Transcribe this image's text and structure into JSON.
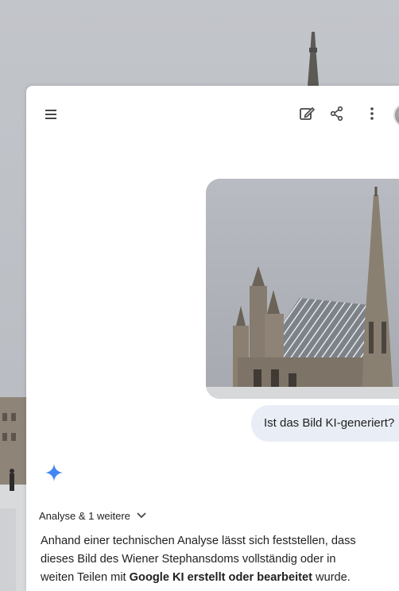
{
  "toolbar": {
    "menu_icon": "hamburger-menu-icon",
    "new_chat_icon": "edit-square-icon",
    "share_icon": "share-icon",
    "more_icon": "more-vert-icon",
    "avatar_icon": "profile-avatar"
  },
  "conversation": {
    "user_prompt": "Ist das Bild KI-generiert?",
    "response_icon": "sparkle-icon",
    "analysis_label": "Analyse & 1 weitere",
    "analysis_toggle_icon": "chevron-down-icon",
    "answer_line1": "Anhand einer technischen Analyse lässt sich feststellen, dass",
    "answer_line2": "dieses Bild des Wiener Stephansdoms vollständig oder in",
    "answer_line3_a": "weiten Teilen mit ",
    "answer_line3_bold": "Google KI erstellt oder bearbeitet",
    "answer_line3_b": " wurde."
  },
  "colors": {
    "panel_bg": "#ffffff",
    "bubble_bg": "#e9eef6",
    "sparkle": "#4285f4",
    "text": "#1f1f1f"
  }
}
